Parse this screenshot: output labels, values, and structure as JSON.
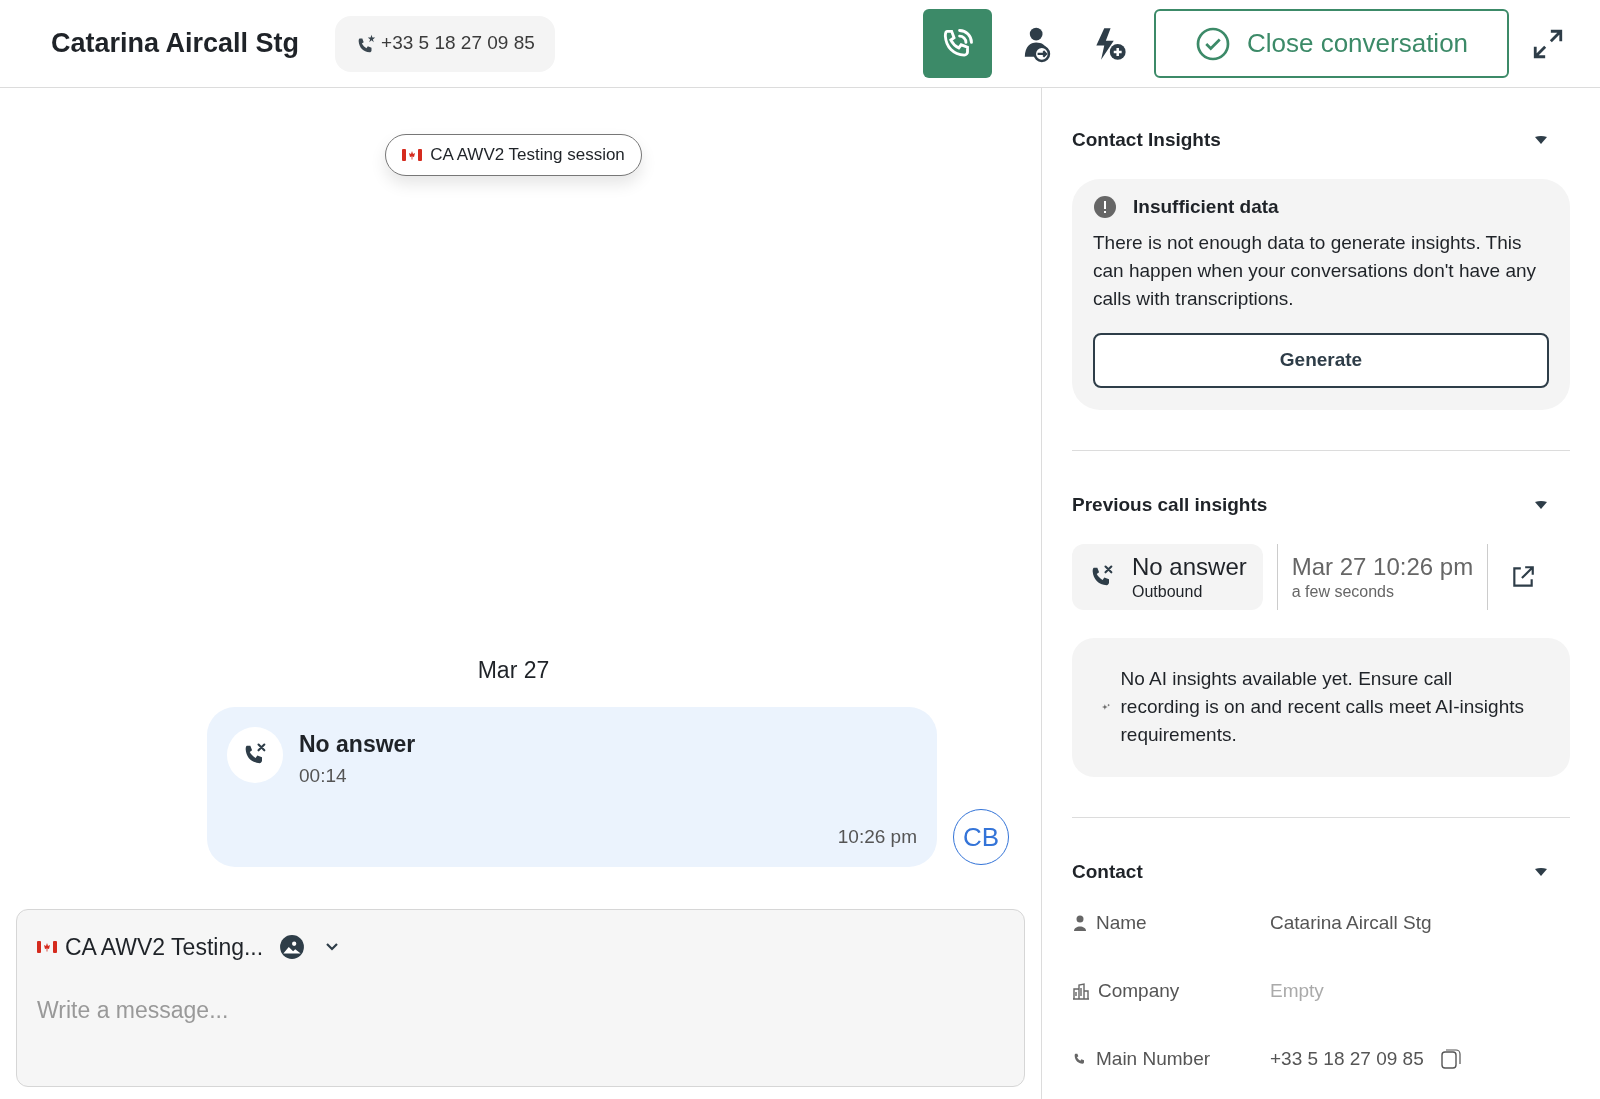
{
  "header": {
    "title": "Catarina Aircall Stg",
    "phone": "+33 5 18 27 09 85",
    "close_button": "Close conversation"
  },
  "conversation": {
    "session_label": "CA AWV2 Testing session",
    "date": "Mar 27",
    "messages": [
      {
        "kind": "call",
        "title": "No answer",
        "duration": "00:14",
        "time": "10:26 pm",
        "avatar": "CB"
      }
    ]
  },
  "composer": {
    "line": "CA AWV2 Testing...",
    "placeholder": "Write a message..."
  },
  "sidebar": {
    "sections": [
      {
        "kind": "insights",
        "title": "Contact Insights",
        "expanded": true,
        "notice_title": "Insufficient data",
        "notice_text": "There is not enough data to generate insights. This can happen when your conversations don't have any calls with transcriptions.",
        "button": "Generate"
      },
      {
        "kind": "calls",
        "title": "Previous call insights",
        "expanded": true,
        "call": {
          "status": "No answer",
          "direction": "Outbound",
          "datetime": "Mar 27 10:26 pm",
          "duration": "a few seconds"
        },
        "ai_text": "No AI insights available yet. Ensure call recording is on and recent calls meet AI-insights requirements."
      },
      {
        "kind": "contact",
        "title": "Contact",
        "expanded": true,
        "fields": [
          {
            "label": "Name",
            "value": "Catarina Aircall Stg",
            "copy": false
          },
          {
            "label": "Company",
            "placeholder": "Empty",
            "copy": false
          },
          {
            "label": "Main Number",
            "value": "+33 5 18 27 09 85",
            "copy": true
          }
        ]
      }
    ]
  }
}
